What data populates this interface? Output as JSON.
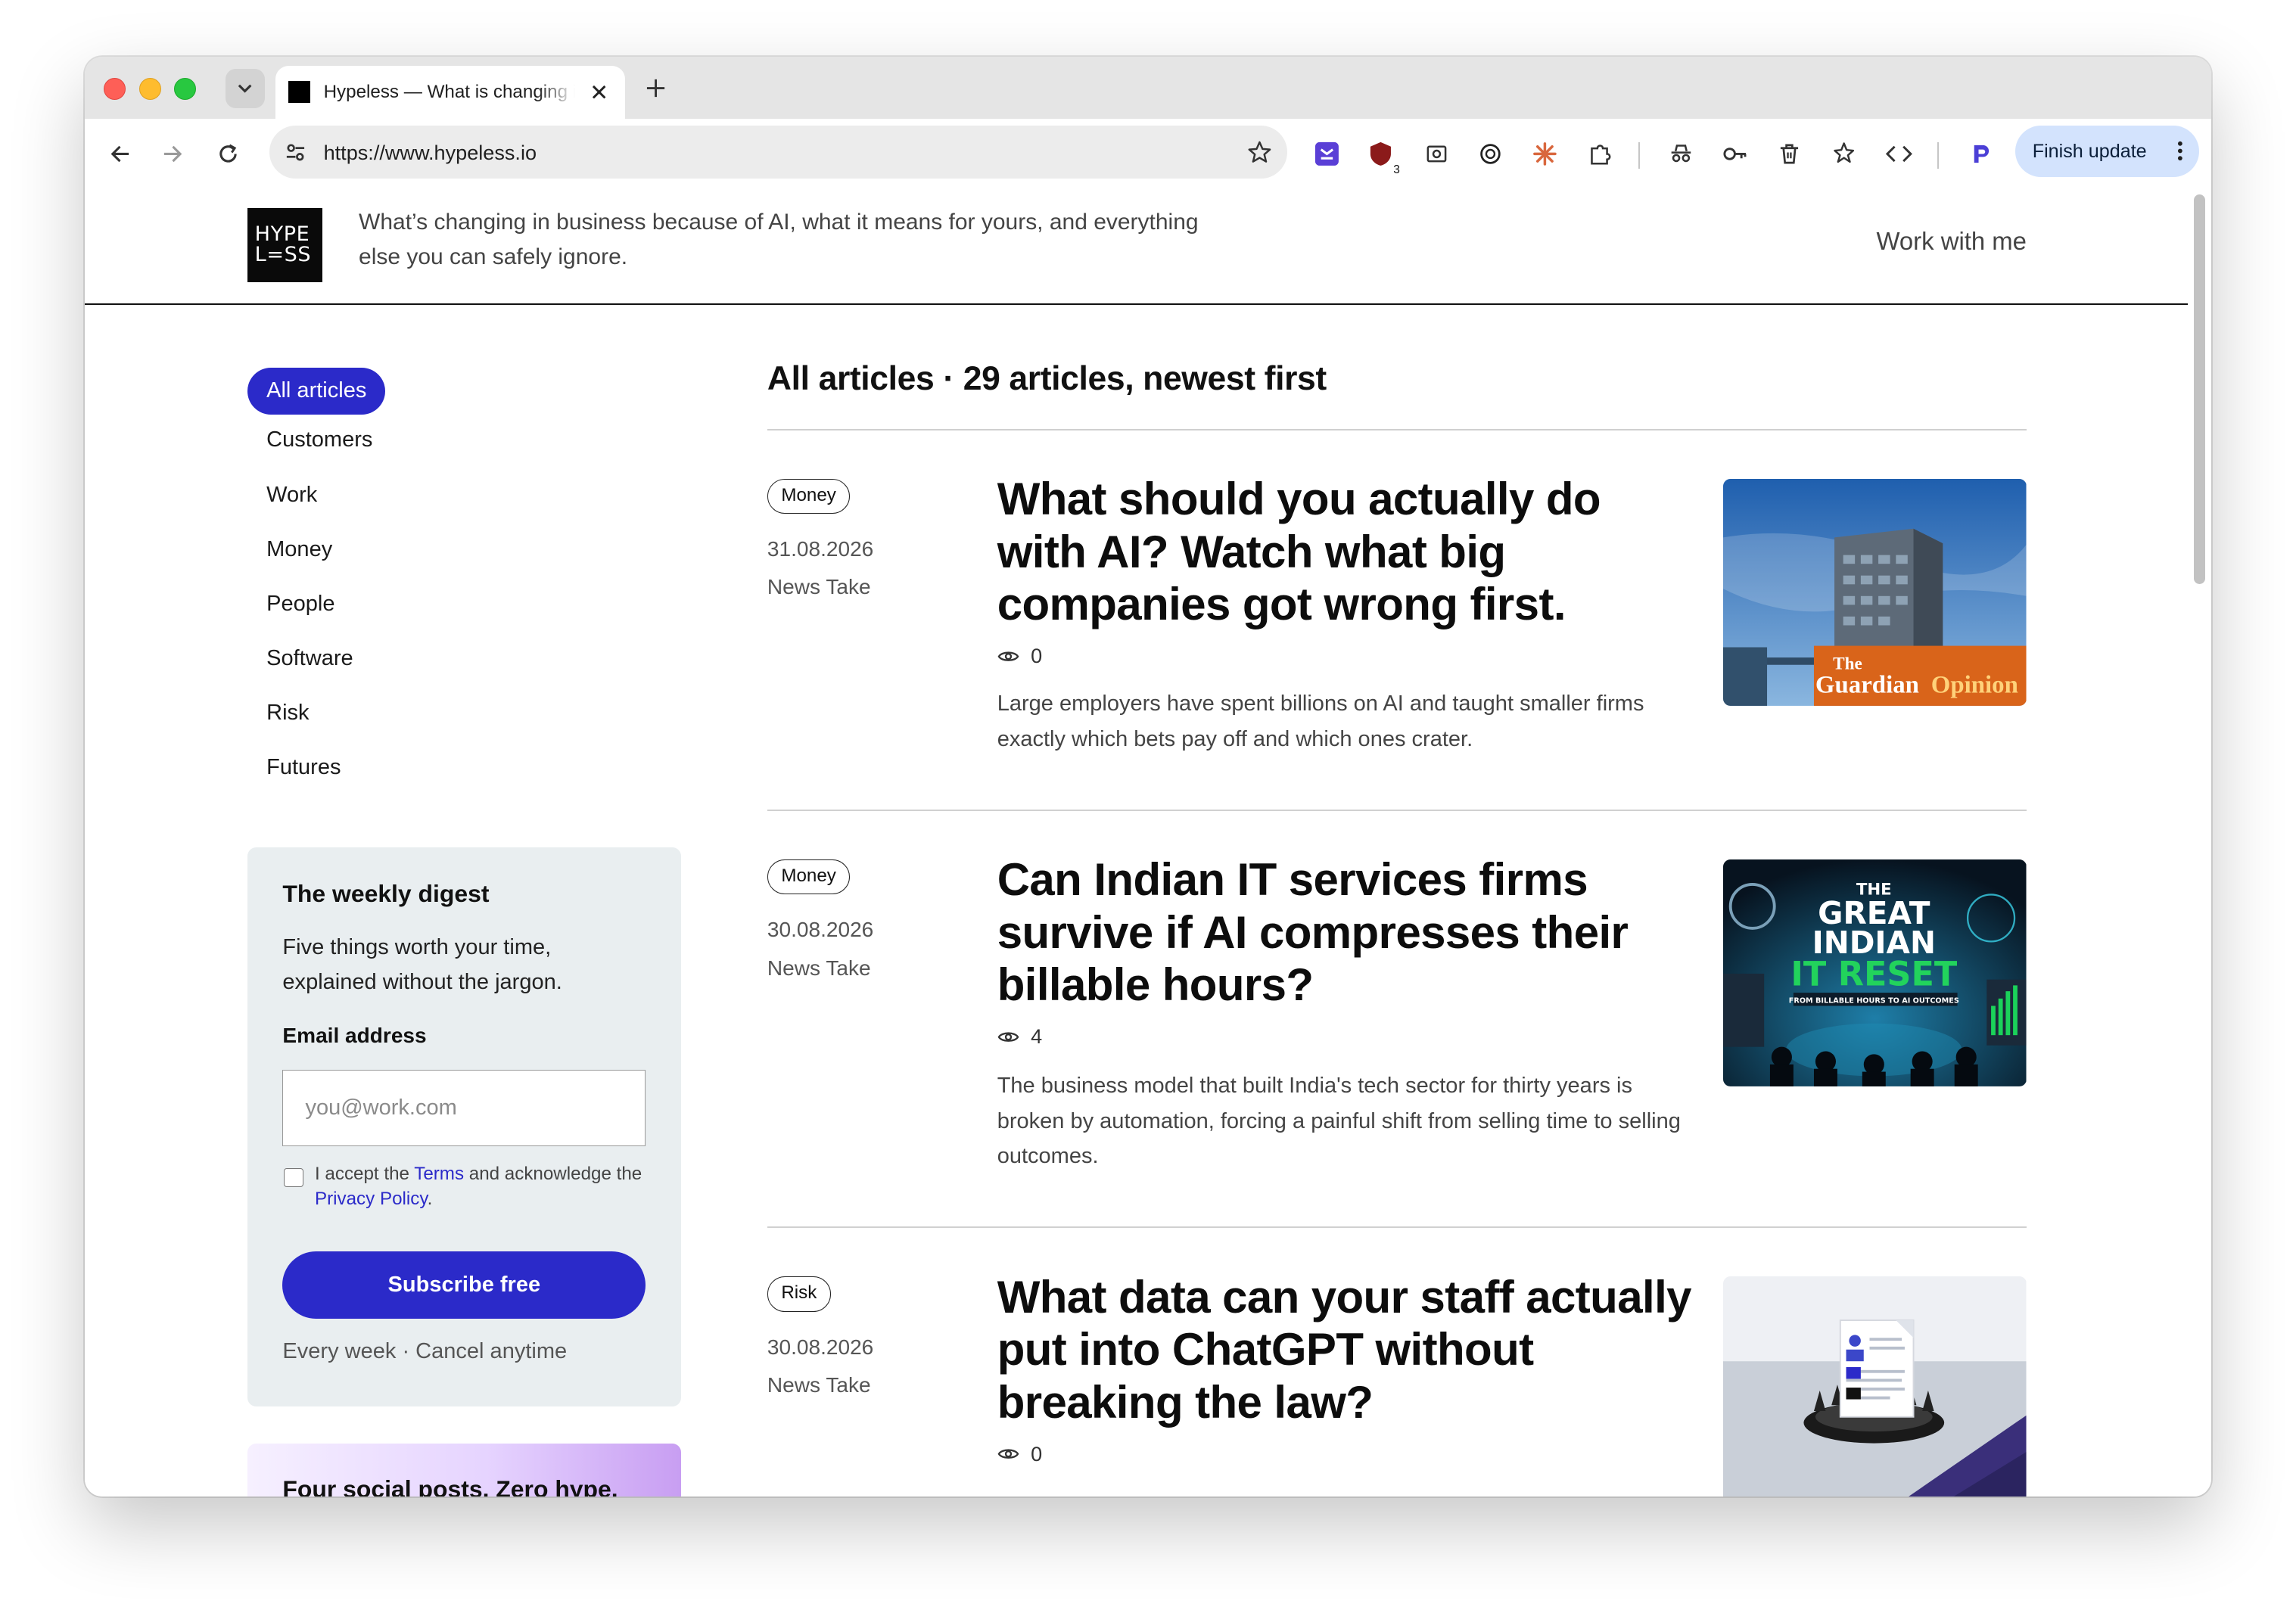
{
  "browser": {
    "tab_title": "Hypeless — What is changing in business",
    "url": "https://www.hypeless.io",
    "finish_update_label": "Finish update",
    "extension_badge_count": "3"
  },
  "site": {
    "logo_line1": "HYPE",
    "logo_line2": "L=SS",
    "tagline": "What’s changing in business because of AI, what it means for yours, and everything else you can safely ignore.",
    "work_with_me": "Work with me"
  },
  "categories": [
    {
      "label": "All articles",
      "active": true
    },
    {
      "label": "Customers"
    },
    {
      "label": "Work"
    },
    {
      "label": "Money"
    },
    {
      "label": "People"
    },
    {
      "label": "Software"
    },
    {
      "label": "Risk"
    },
    {
      "label": "Futures"
    }
  ],
  "digest": {
    "title": "The weekly digest",
    "description": "Five things worth your time, explained without the jargon.",
    "email_label": "Email address",
    "email_placeholder": "you@work.com",
    "consent_1": "I accept the ",
    "consent_terms": "Terms",
    "consent_2": " and acknowledge the ",
    "consent_privacy": "Privacy Policy",
    "consent_3": ".",
    "subscribe_label": "Subscribe free",
    "footnote": "Every week · Cancel anytime"
  },
  "promo": {
    "title": "Four social posts. Zero hype."
  },
  "list": {
    "heading": "All articles · 29 articles, newest first"
  },
  "articles": [
    {
      "tag": "Money",
      "date": "31.08.2026",
      "type": "News Take",
      "title": "What should you actually do with AI? Watch what big companies got wrong first.",
      "views": "0",
      "summary": "Large employers have spent billions on AI and taught smaller firms exactly which bets pay off and which ones crater.",
      "thumb_text_1": "The",
      "thumb_text_2": "Guardian",
      "thumb_text_3": "Opinion"
    },
    {
      "tag": "Money",
      "date": "30.08.2026",
      "type": "News Take",
      "title": "Can Indian IT services firms survive if AI compresses their billable hours?",
      "views": "4",
      "summary": "The business model that built India's tech sector for thirty years is broken by automation, forcing a painful shift from selling time to selling outcomes.",
      "thumb_text_1": "THE",
      "thumb_text_2": "GREAT",
      "thumb_text_3": "INDIAN",
      "thumb_text_4": "IT RESET",
      "thumb_text_5": "FROM BILLABLE HOURS TO AI OUTCOMES"
    },
    {
      "tag": "Risk",
      "date": "30.08.2026",
      "type": "News Take",
      "title": "What data can your staff actually put into ChatGPT without breaking the law?",
      "views": "0",
      "summary": ""
    }
  ],
  "colors": {
    "accent": "#2b2ac9",
    "digest_bg": "#e9eef0",
    "finish_update_bg": "#d3e3fd"
  }
}
